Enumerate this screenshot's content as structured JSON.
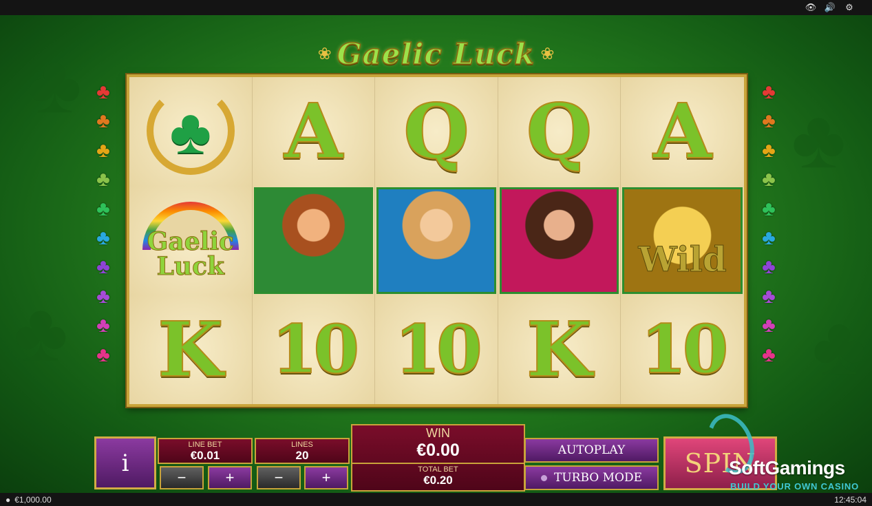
{
  "topbar": {
    "icons": [
      "eye-icon",
      "volume-icon",
      "gear-icon"
    ]
  },
  "game": {
    "title": "Gaelic Luck"
  },
  "reels": {
    "rows": [
      [
        "clover-horseshoe",
        "A",
        "Q",
        "Q",
        "A"
      ],
      [
        "gaelic-luck-logo",
        "leprechaun-girl",
        "blonde-girl",
        "brunette-girl",
        "wild-pot"
      ],
      [
        "gaelic-luck-logo",
        "10",
        "10",
        "K",
        "10"
      ]
    ],
    "logo_text_1": "Gaelic",
    "logo_text_2": "Luck",
    "wild_text": "Wild",
    "row3_first": "K"
  },
  "gems": {
    "colors": [
      "#e53935",
      "#e0781f",
      "#e5a516",
      "#8bc34a",
      "#2ec15a",
      "#29a8e0",
      "#8e44d6",
      "#a64bd6",
      "#d23fb7",
      "#e6338a"
    ]
  },
  "panel": {
    "info_label": "i",
    "line_bet_label": "LINE BET",
    "line_bet_value": "€0.01",
    "lines_label": "LINES",
    "lines_value": "20",
    "minus": "−",
    "plus": "+",
    "win_label": "WIN",
    "win_value": "€0.00",
    "total_bet_label": "TOTAL BET",
    "total_bet_value": "€0.20",
    "autoplay_label": "AUTOPLAY",
    "turbo_label": "TURBO MODE",
    "spin_label": "SPIN"
  },
  "branding": {
    "name": "SoftGamings",
    "tagline": "BUILD YOUR OWN CASINO"
  },
  "bottombar": {
    "balance": "€1,000.00",
    "clock": "12:45:04"
  }
}
